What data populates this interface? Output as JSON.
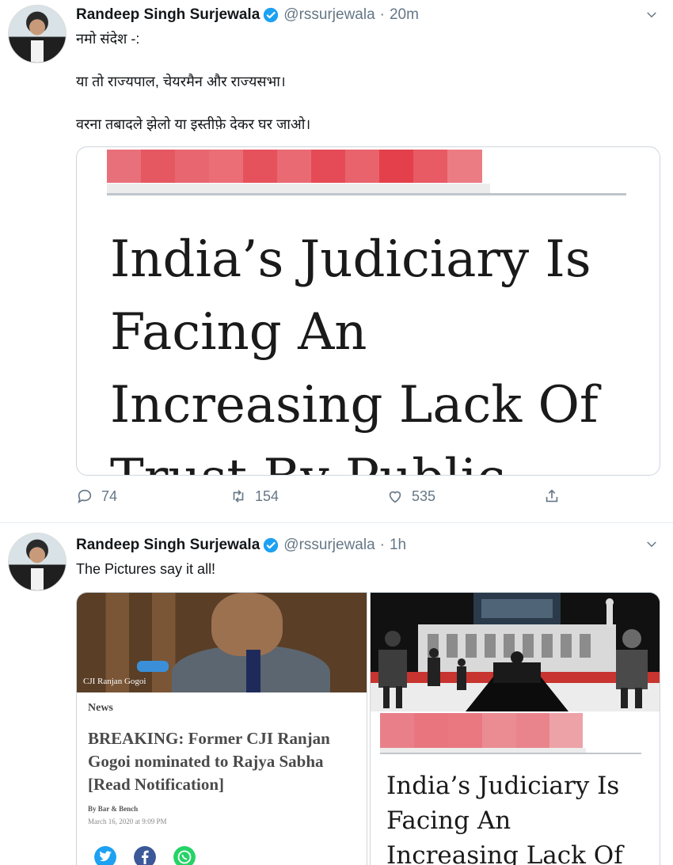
{
  "tweets": [
    {
      "name": "Randeep Singh Surjewala",
      "handle": "@rssurjewala",
      "separator": "·",
      "time": "20m",
      "lines": [
        "नमो संदेश -:",
        "या तो राज्यपाल, चेयरमैन और राज्यसभा।",
        "वरना तबादले झेलो या इस्तीफ़े देकर घर जाओ।"
      ],
      "card": {
        "headline_lines": [
          "India’s Judiciary Is",
          "Facing An",
          "Increasing Lack Of",
          "Trust By Public"
        ]
      },
      "actions": {
        "replies": "74",
        "retweets": "154",
        "likes": "535"
      }
    },
    {
      "name": "Randeep Singh Surjewala",
      "handle": "@rssurjewala",
      "separator": "·",
      "time": "1h",
      "text": "The Pictures say it all!",
      "left_image": {
        "caption": "CJI Ranjan Gogoi",
        "label": "News",
        "title": "BREAKING: Former CJI Ranjan Gogoi nominated to Rajya Sabha [Read Notification]",
        "byline": "By Bar & Bench",
        "date": "March 16, 2020 at 9:09 PM"
      },
      "right_image": {
        "headline_lines": [
          "India’s Judiciary Is",
          "Facing An",
          "Increasing Lack Of"
        ]
      }
    }
  ],
  "colors": {
    "verified": "#1da1f2",
    "secondary_text": "#657786",
    "redaction": "#e8505b",
    "facebook": "#3b5998",
    "whatsapp": "#25d366",
    "twitter": "#1da1f2"
  },
  "icons": [
    "verified-badge-icon",
    "chevron-down-icon",
    "reply-icon",
    "retweet-icon",
    "like-icon",
    "share-icon",
    "twitter-share-icon",
    "facebook-share-icon",
    "whatsapp-share-icon"
  ]
}
